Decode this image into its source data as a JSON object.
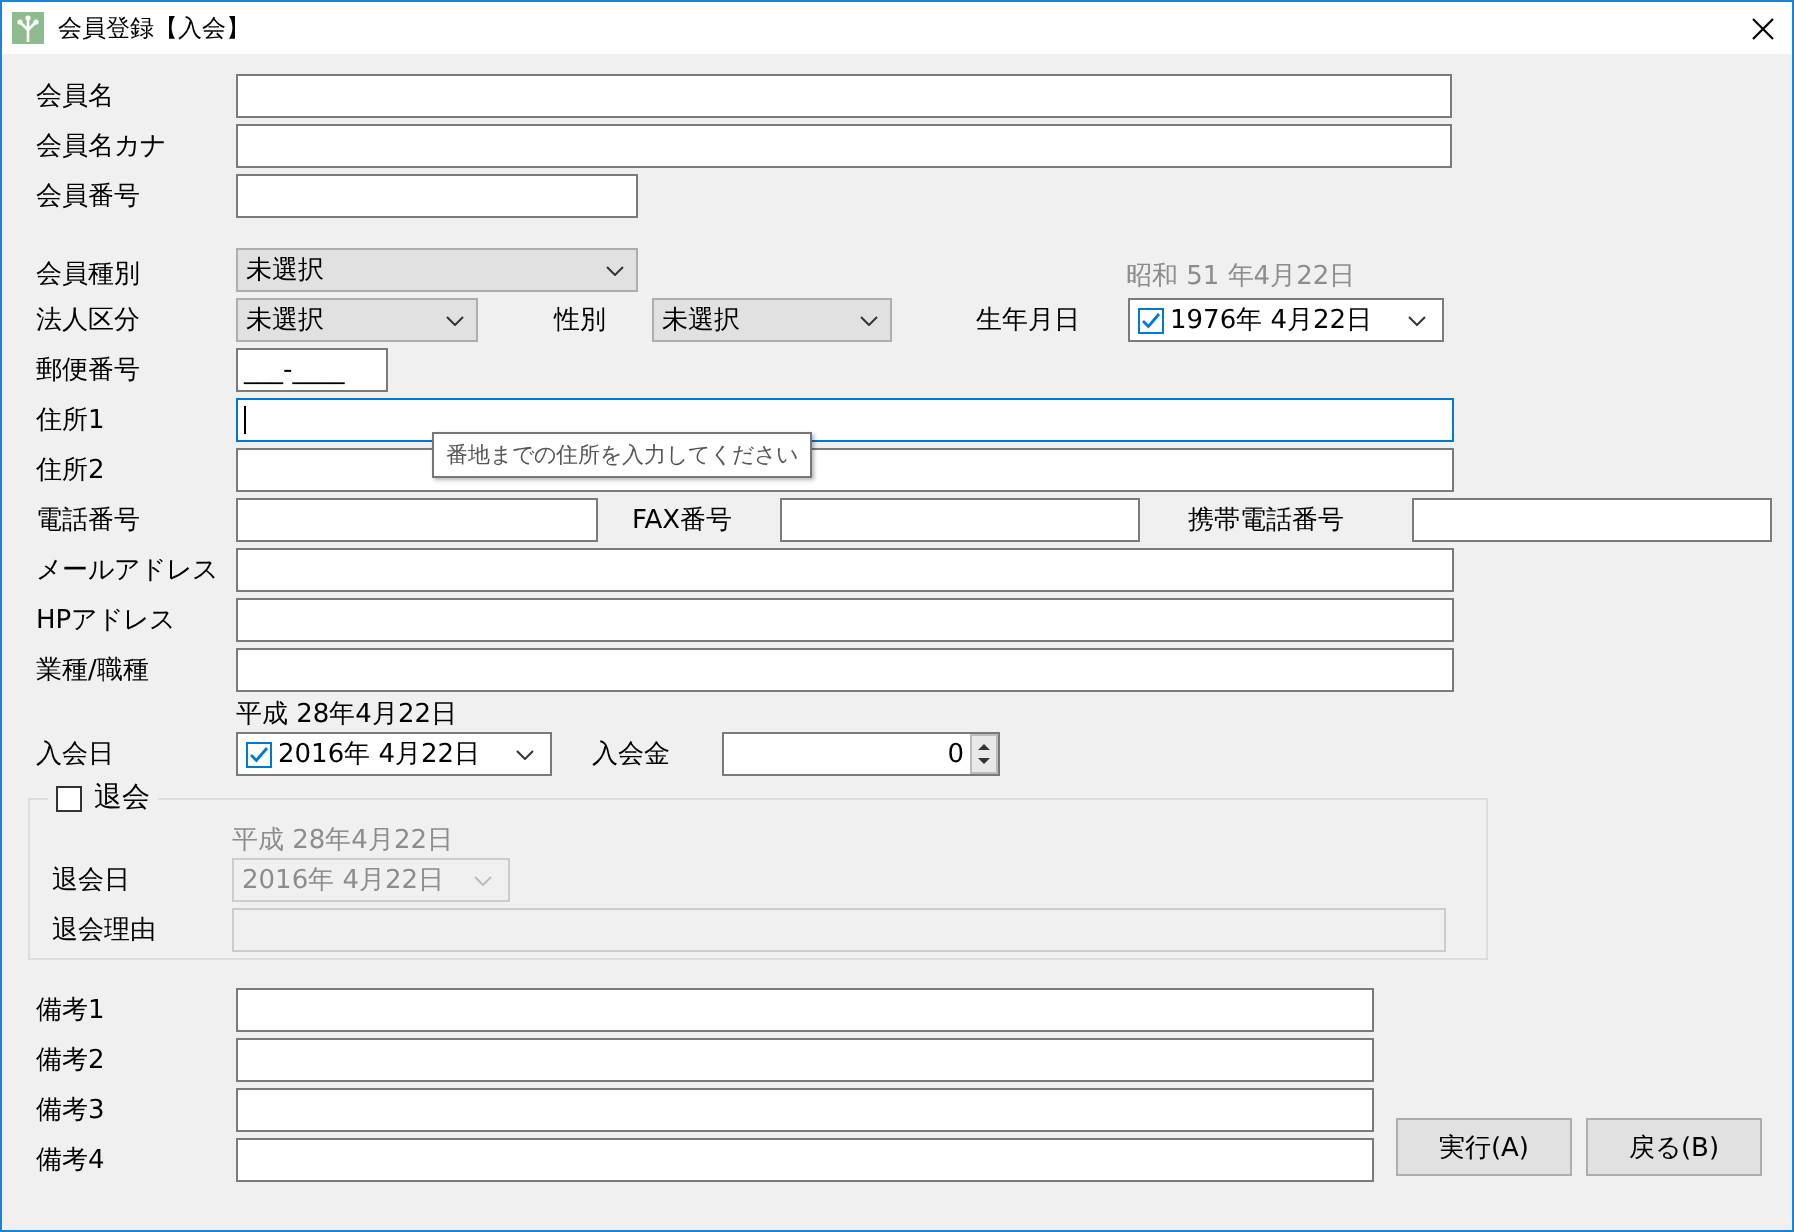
{
  "window": {
    "title": "会員登録【入会】"
  },
  "member_name": {
    "label": "会員名"
  },
  "member_kana": {
    "label": "会員名カナ"
  },
  "member_number": {
    "label": "会員番号"
  },
  "member_type": {
    "label": "会員種別",
    "value": "未選択"
  },
  "corporate": {
    "label": "法人区分",
    "value": "未選択"
  },
  "gender": {
    "label": "性別",
    "value": "未選択"
  },
  "birth": {
    "label": "生年月日",
    "era": "昭和 51 年4月22日",
    "era_muted": true,
    "checked": true,
    "date": "1976年  4月22日"
  },
  "postal": {
    "label": "郵便番号",
    "value": "___-____"
  },
  "address1": {
    "label": "住所1",
    "focused": true,
    "tooltip": "番地までの住所を入力してください"
  },
  "address2": {
    "label": "住所2",
    "focused": false
  },
  "phones": [
    {
      "label": "電話番号"
    },
    {
      "label": "FAX番号"
    },
    {
      "label": "携帯電話番号"
    }
  ],
  "email": {
    "label": "メールアドレス"
  },
  "homepage": {
    "label": "HPアドレス"
  },
  "occupation": {
    "label": "業種/職種"
  },
  "join": {
    "label": "入会日",
    "era": "平成 28年4月22日",
    "era_muted": false,
    "checked": true,
    "date": "2016年  4月22日"
  },
  "fee": {
    "label": "入会金",
    "value": "0"
  },
  "withdraw": {
    "label": "退会",
    "checked": false,
    "date_label": "退会日",
    "era": "平成 28年4月22日",
    "date": "2016年  4月22日",
    "reason_label": "退会理由"
  },
  "notes": [
    {
      "label": "備考1"
    },
    {
      "label": "備考2"
    },
    {
      "label": "備考3"
    },
    {
      "label": "備考4"
    }
  ],
  "buttons": [
    {
      "label": "実行(A)"
    },
    {
      "label": "戻る(B)"
    }
  ]
}
